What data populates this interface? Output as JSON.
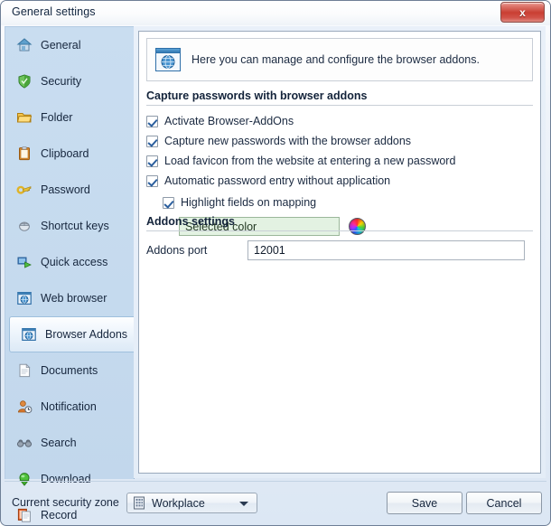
{
  "window": {
    "title": "General settings",
    "close_label": "x"
  },
  "sidebar": {
    "items": [
      {
        "label": "General",
        "icon": "home-icon",
        "selected": false
      },
      {
        "label": "Security",
        "icon": "shield-icon",
        "selected": false
      },
      {
        "label": "Folder",
        "icon": "folder-icon",
        "selected": false
      },
      {
        "label": "Clipboard",
        "icon": "clipboard-icon",
        "selected": false
      },
      {
        "label": "Password",
        "icon": "key-icon",
        "selected": false
      },
      {
        "label": "Shortcut keys",
        "icon": "mouse-icon",
        "selected": false
      },
      {
        "label": "Quick access",
        "icon": "quick-access-icon",
        "selected": false
      },
      {
        "label": "Web browser",
        "icon": "globe-window-icon",
        "selected": false
      },
      {
        "label": "Browser Addons",
        "icon": "globe-window-icon",
        "selected": true
      },
      {
        "label": "Documents",
        "icon": "document-icon",
        "selected": false
      },
      {
        "label": "Notification",
        "icon": "user-clock-icon",
        "selected": false
      },
      {
        "label": "Search",
        "icon": "binoculars-icon",
        "selected": false
      },
      {
        "label": "Download",
        "icon": "download-icon",
        "selected": false
      },
      {
        "label": "Record",
        "icon": "record-copy-icon",
        "selected": false
      }
    ]
  },
  "main": {
    "info": {
      "icon": "browser-globe-icon",
      "text": "Here you can manage and configure the browser addons."
    },
    "capture_group": {
      "title": "Capture passwords with browser addons",
      "checkboxes": [
        {
          "label": "Activate Browser-AddOns",
          "checked": true
        },
        {
          "label": "Capture new passwords with the browser addons",
          "checked": true
        },
        {
          "label": "Load favicon from the website at entering a new password",
          "checked": true
        },
        {
          "label": "Automatic password entry without application",
          "checked": true
        }
      ],
      "sub_checkbox": {
        "label": "Highlight fields on mapping",
        "checked": true
      },
      "color_field": {
        "value": "Selected color",
        "icon": "color-wheel-icon"
      }
    },
    "addons_group": {
      "title": "Addons settings",
      "port_label": "Addons port",
      "port_value": "12001"
    }
  },
  "footer": {
    "zone_label": "Current security zone",
    "zone_value": "Workplace",
    "zone_icon": "building-icon",
    "save_label": "Save",
    "cancel_label": "Cancel"
  }
}
